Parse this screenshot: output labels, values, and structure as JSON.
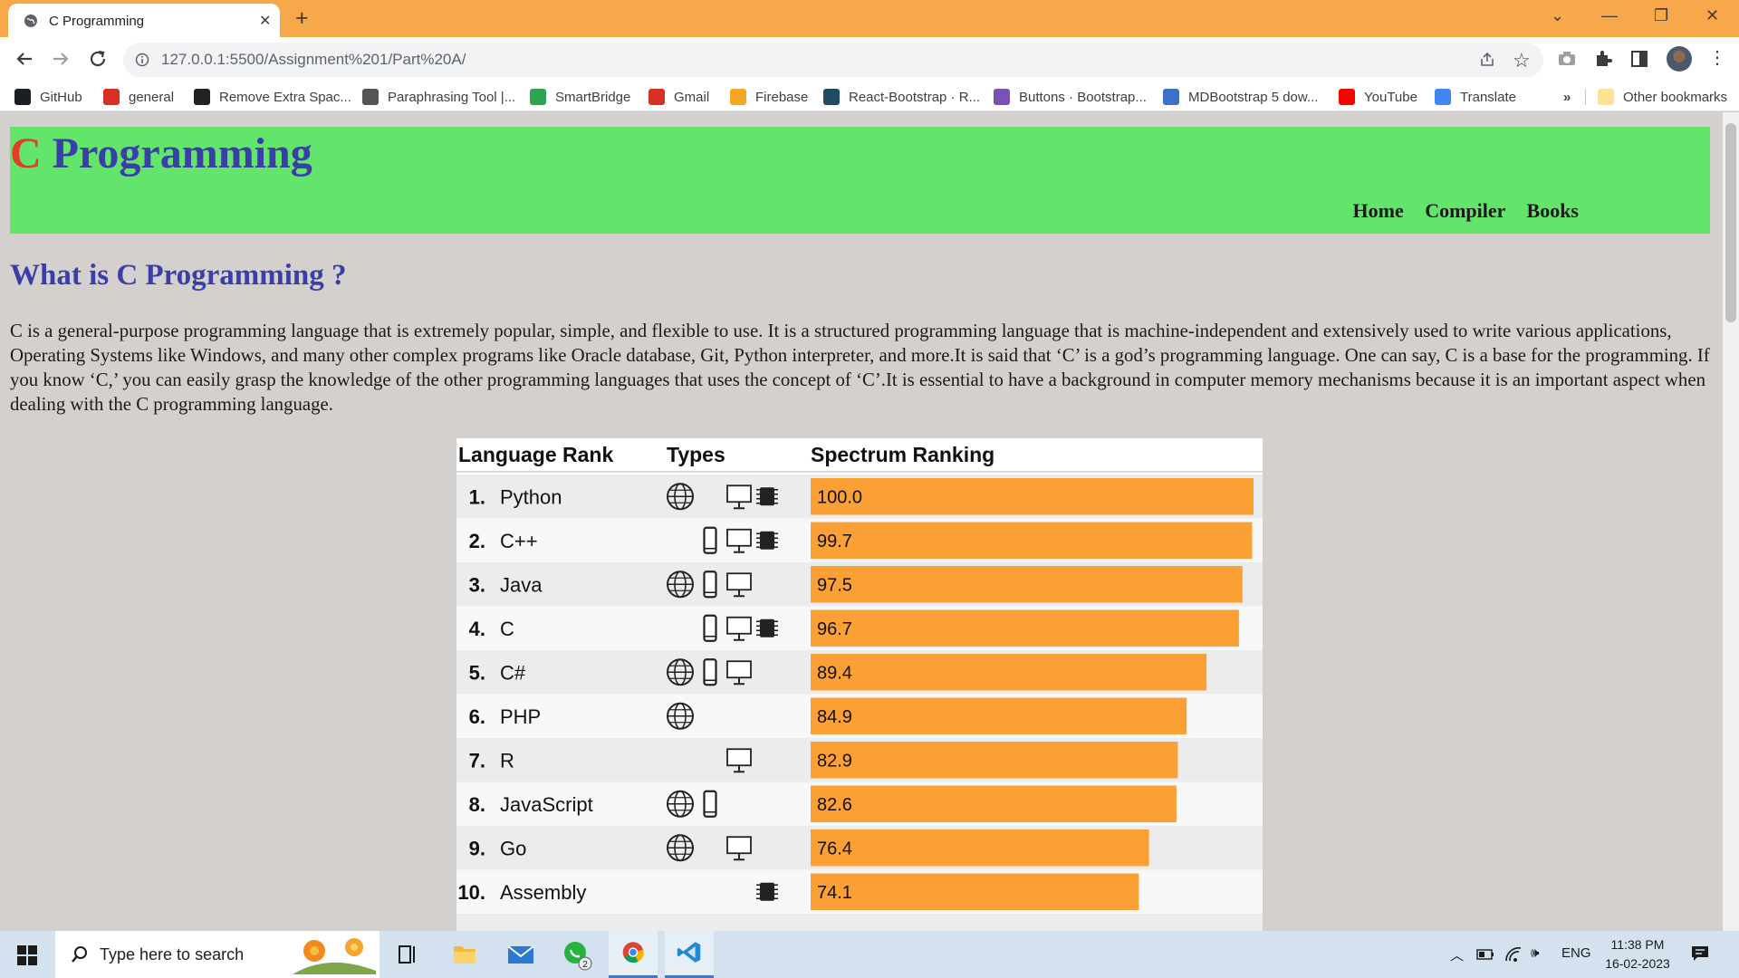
{
  "browser": {
    "tab_title": "C Programming",
    "url": "127.0.0.1:5500/Assignment%201/Part%20A/",
    "bookmarks": [
      {
        "label": "GitHub",
        "icon": "github-icon",
        "color": "#1b1f23"
      },
      {
        "label": "general",
        "icon": "general-icon",
        "color": "#d93025"
      },
      {
        "label": "Remove Extra Spac...",
        "icon": "cb-icon",
        "color": "#222222"
      },
      {
        "label": "Paraphrasing Tool |...",
        "icon": "quill-icon",
        "color": "#555555"
      },
      {
        "label": "SmartBridge",
        "icon": "smartbridge-icon",
        "color": "#2ea44f"
      },
      {
        "label": "Gmail",
        "icon": "gmail-icon",
        "color": "#d93025"
      },
      {
        "label": "Firebase",
        "icon": "firebase-icon",
        "color": "#f6a623"
      },
      {
        "label": "React-Bootstrap · R...",
        "icon": "react-bootstrap-icon",
        "color": "#1f4b63"
      },
      {
        "label": "Buttons · Bootstrap...",
        "icon": "bootstrap-icon",
        "color": "#7952b3"
      },
      {
        "label": "MDBootstrap 5 dow...",
        "icon": "mdb-icon",
        "color": "#3b71ca"
      },
      {
        "label": "YouTube",
        "icon": "youtube-icon",
        "color": "#ff0000"
      },
      {
        "label": "Translate",
        "icon": "translate-icon",
        "color": "#4285f4"
      }
    ],
    "more_label": "»",
    "other_bookmarks": "Other bookmarks"
  },
  "page": {
    "logo_c": "C",
    "logo_rest": " Programming",
    "nav": [
      "Home",
      "Compiler",
      "Books"
    ],
    "section_title": "What is C Programming ?",
    "paragraph": "C is a general-purpose programming language that is extremely popular, simple, and flexible to use. It is a structured programming language that is machine-independent and extensively used to write various applications, Operating Systems like Windows, and many other complex programs like Oracle database, Git, Python interpreter, and more.It is said that ‘C’ is a god’s programming language. One can say, C is a base for the programming. If you know ‘C,’ you can easily grasp the knowledge of the other programming languages that uses the concept of ‘C’.It is essential to have a background in computer memory mechanisms because it is an important aspect when dealing with the C programming language."
  },
  "chart_data": {
    "type": "table",
    "columns": [
      "Language Rank",
      "Types",
      "Spectrum Ranking"
    ],
    "bar_color": "#fba034",
    "max_value": 100,
    "rows": [
      {
        "rank": "1.",
        "language": "Python",
        "types": [
          "web",
          "",
          "desktop",
          "embedded"
        ],
        "score": 100.0,
        "score_label": "100.0"
      },
      {
        "rank": "2.",
        "language": "C++",
        "types": [
          "",
          "mobile",
          "desktop",
          "embedded"
        ],
        "score": 99.7,
        "score_label": "99.7"
      },
      {
        "rank": "3.",
        "language": "Java",
        "types": [
          "web",
          "mobile",
          "desktop",
          ""
        ],
        "score": 97.5,
        "score_label": "97.5"
      },
      {
        "rank": "4.",
        "language": "C",
        "types": [
          "",
          "mobile",
          "desktop",
          "embedded"
        ],
        "score": 96.7,
        "score_label": "96.7"
      },
      {
        "rank": "5.",
        "language": "C#",
        "types": [
          "web",
          "mobile",
          "desktop",
          ""
        ],
        "score": 89.4,
        "score_label": "89.4"
      },
      {
        "rank": "6.",
        "language": "PHP",
        "types": [
          "web",
          "",
          "",
          ""
        ],
        "score": 84.9,
        "score_label": "84.9"
      },
      {
        "rank": "7.",
        "language": "R",
        "types": [
          "",
          "",
          "desktop",
          ""
        ],
        "score": 82.9,
        "score_label": "82.9"
      },
      {
        "rank": "8.",
        "language": "JavaScript",
        "types": [
          "web",
          "mobile",
          "",
          ""
        ],
        "score": 82.6,
        "score_label": "82.6"
      },
      {
        "rank": "9.",
        "language": "Go",
        "types": [
          "web",
          "",
          "desktop",
          ""
        ],
        "score": 76.4,
        "score_label": "76.4"
      },
      {
        "rank": "10.",
        "language": "Assembly",
        "types": [
          "",
          "",
          "",
          "embedded"
        ],
        "score": 74.1,
        "score_label": "74.1"
      }
    ]
  },
  "taskbar": {
    "search_placeholder": "Type here to search",
    "whatsapp_badge": "2",
    "language": "ENG",
    "time": "11:38 PM",
    "date": "16-02-2023"
  }
}
